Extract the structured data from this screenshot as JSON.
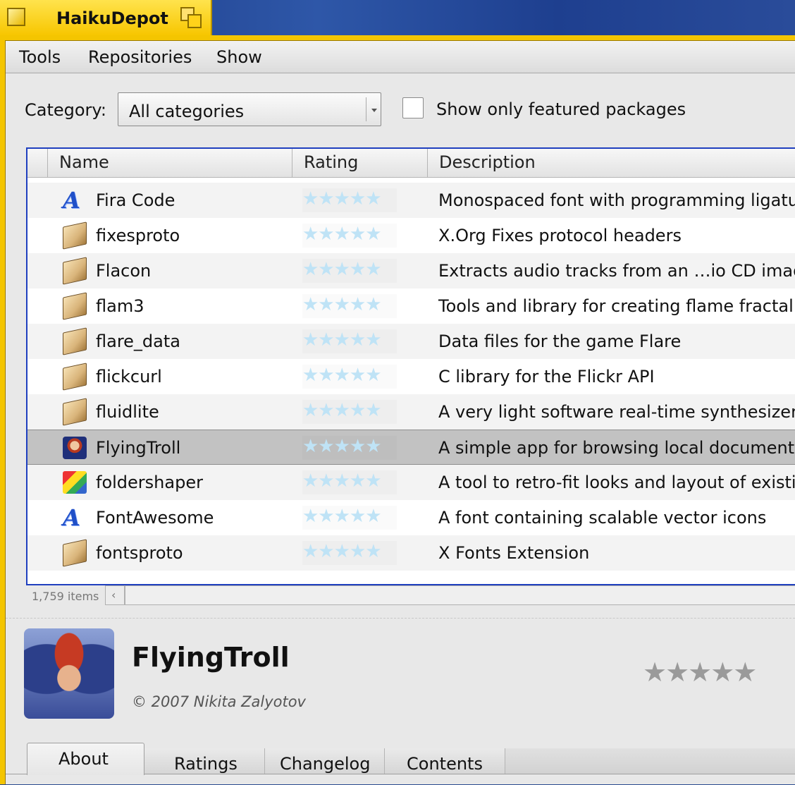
{
  "window": {
    "title": "HaikuDepot"
  },
  "menu": {
    "tools": "Tools",
    "repositories": "Repositories",
    "show": "Show"
  },
  "filter": {
    "category_label": "Category:",
    "category_value": "All categories",
    "featured_label": "Show only featured packages",
    "featured_checked": false
  },
  "list": {
    "columns": {
      "name": "Name",
      "rating": "Rating",
      "description": "Description"
    },
    "rows": [
      {
        "icon": "font-icon",
        "name": "Fira Code",
        "rating": "★★★★★",
        "description": "Monospaced font with programming ligatu"
      },
      {
        "icon": "package-icon",
        "name": "fixesproto",
        "rating": "★★★★★",
        "description": "X.Org Fixes protocol headers"
      },
      {
        "icon": "package-icon",
        "name": "Flacon",
        "rating": "★★★★★",
        "description": "Extracts audio tracks from an …io CD image"
      },
      {
        "icon": "package-icon",
        "name": "flam3",
        "rating": "★★★★★",
        "description": "Tools and library for creating flame fractal i"
      },
      {
        "icon": "package-icon",
        "name": "flare_data",
        "rating": "★★★★★",
        "description": "Data files for the game Flare"
      },
      {
        "icon": "package-icon",
        "name": "flickcurl",
        "rating": "★★★★★",
        "description": "C library for the Flickr API"
      },
      {
        "icon": "package-icon",
        "name": "fluidlite",
        "rating": "★★★★★",
        "description": "A very light software real-time synthesizer"
      },
      {
        "icon": "troll-icon",
        "name": "FlyingTroll",
        "rating": "★★★★★",
        "description": "A simple app for browsing local documenta",
        "selected": true
      },
      {
        "icon": "foldershaper-icon",
        "name": "foldershaper",
        "rating": "★★★★★",
        "description": "A tool to retro-fit looks and layout of existin"
      },
      {
        "icon": "font-icon",
        "name": "FontAwesome",
        "rating": "★★★★★",
        "description": "A font containing scalable vector icons"
      },
      {
        "icon": "package-icon",
        "name": "fontsproto",
        "rating": "★★★★★",
        "description": "X Fonts Extension"
      }
    ],
    "item_count": "1,759 items"
  },
  "detail": {
    "name": "FlyingTroll",
    "copyright": "© 2007 Nikita Zalyotov",
    "rating": "★★★★★"
  },
  "tabs": {
    "about": "About",
    "ratings": "Ratings",
    "changelog": "Changelog",
    "contents": "Contents"
  },
  "colors": {
    "window_tab": "#f7c600",
    "list_focus": "#1f3fbf",
    "selected_row": "#c2c2c2",
    "empty_star": "#bfe3f6"
  }
}
